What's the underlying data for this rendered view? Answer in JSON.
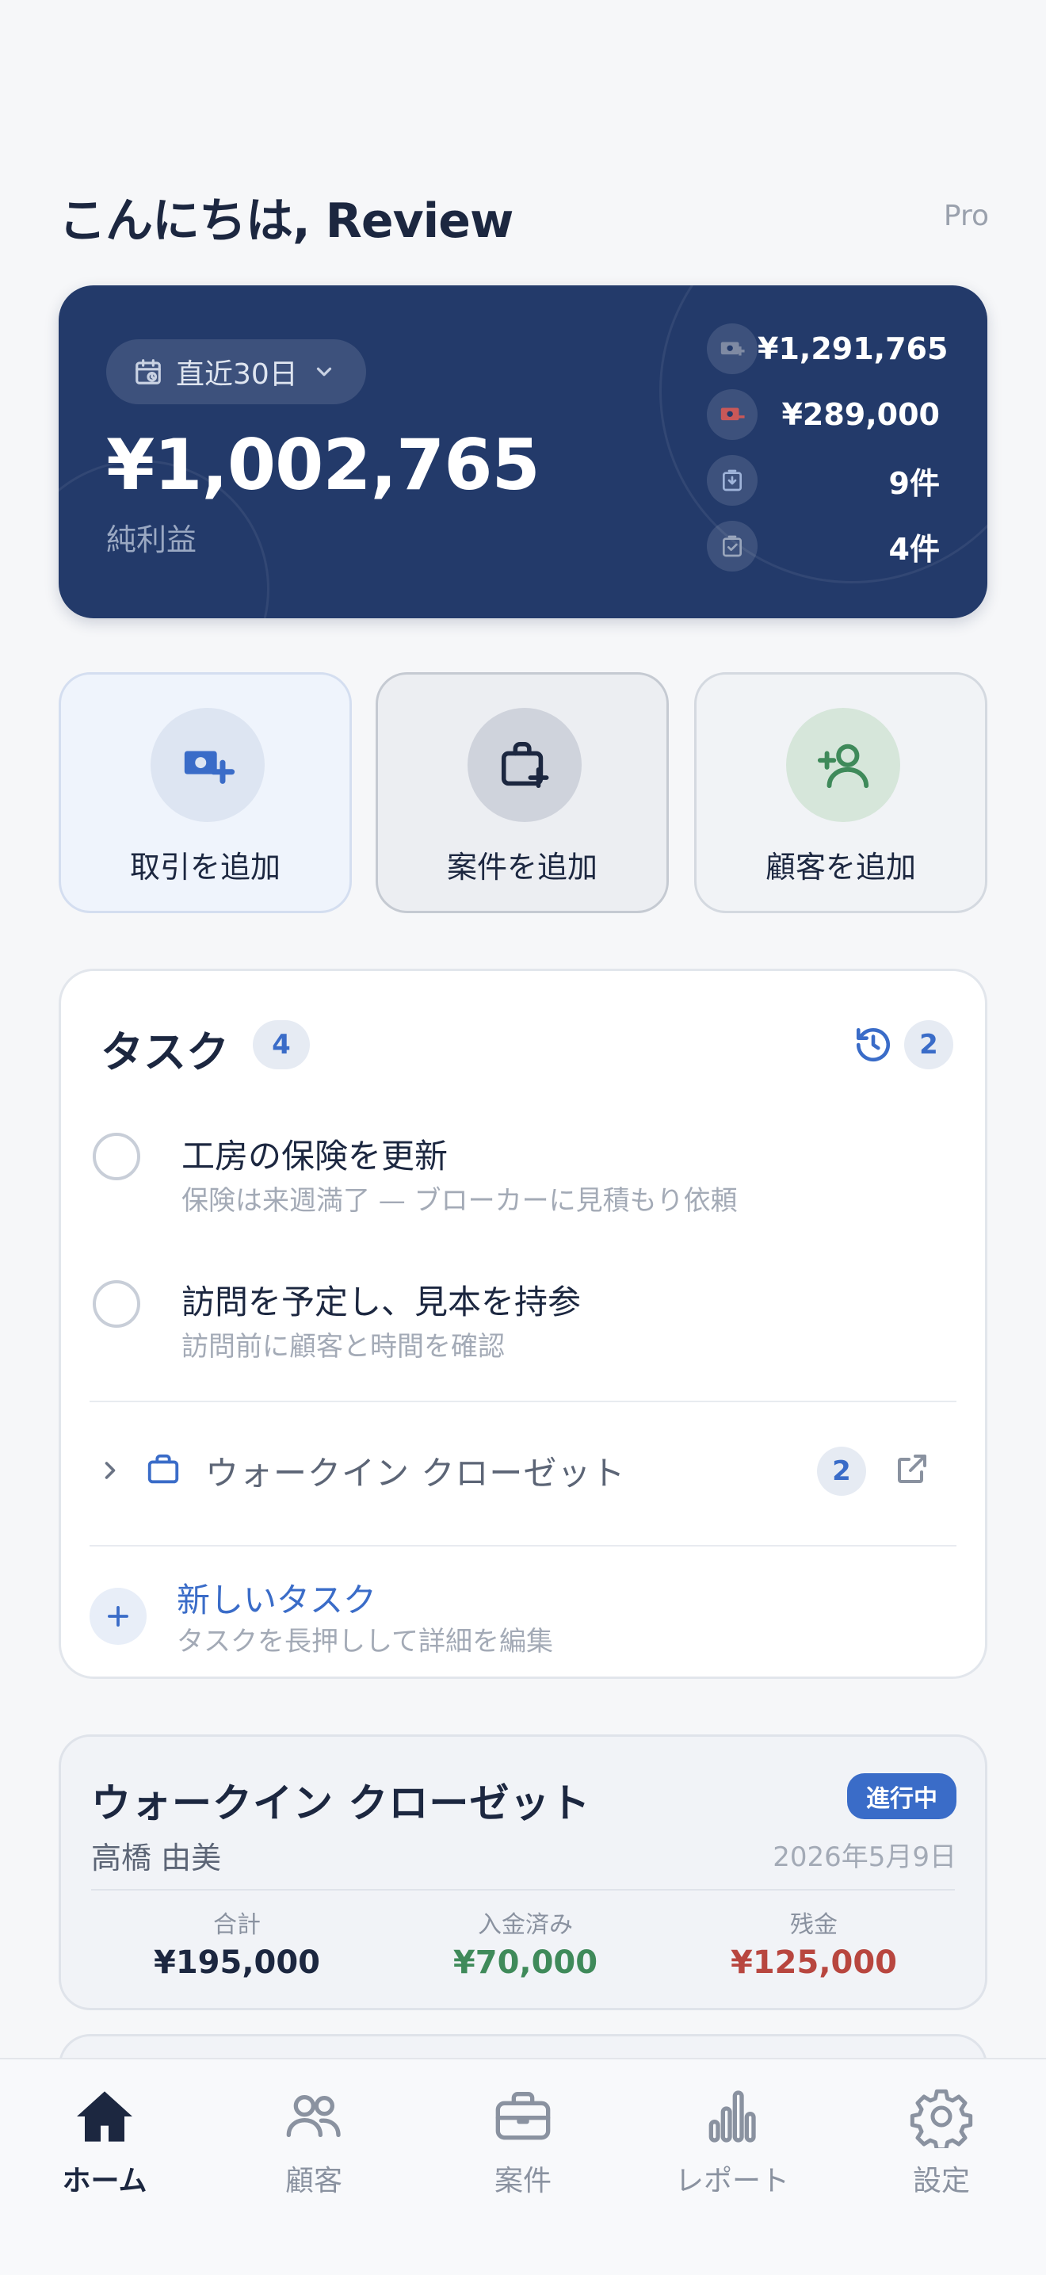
{
  "header": {
    "greeting": "こんにちは, Review",
    "plan": "Pro"
  },
  "summary": {
    "period": "直近30日",
    "net_amount": "¥1,002,765",
    "net_label": "純利益",
    "stats": [
      {
        "icon": "income-icon",
        "value": "¥1,291,765"
      },
      {
        "icon": "expense-icon",
        "value": "¥289,000"
      },
      {
        "icon": "inbox-icon",
        "value": "9件"
      },
      {
        "icon": "completed-icon",
        "value": "4件"
      }
    ]
  },
  "quick_actions": [
    {
      "label": "取引を追加",
      "icon": "add-transaction-icon"
    },
    {
      "label": "案件を追加",
      "icon": "add-project-icon"
    },
    {
      "label": "顧客を追加",
      "icon": "add-customer-icon"
    }
  ],
  "tasks": {
    "title": "タスク",
    "count": "4",
    "history_count": "2",
    "items": [
      {
        "title": "工房の保険を更新",
        "subtitle": "保険は来週満了 — ブローカーに見積もり依頼"
      },
      {
        "title": "訪問を予定し、見本を持参",
        "subtitle": "訪問前に顧客と時間を確認"
      }
    ],
    "group": {
      "label": "ウォークイン クローゼット",
      "count": "2"
    },
    "new_task": {
      "title": "新しいタスク",
      "subtitle": "タスクを長押しして詳細を編集"
    }
  },
  "project": {
    "title": "ウォークイン クローゼット",
    "status": "進行中",
    "client": "高橋 由美",
    "date": "2026年5月9日",
    "total_label": "合計",
    "total_value": "¥195,000",
    "paid_label": "入金済み",
    "paid_value": "¥70,000",
    "balance_label": "残金",
    "balance_value": "¥125,000"
  },
  "tabbar": {
    "items": [
      {
        "label": "ホーム",
        "icon": "home-icon",
        "active": true
      },
      {
        "label": "顧客",
        "icon": "customers-icon"
      },
      {
        "label": "案件",
        "icon": "briefcase-icon"
      },
      {
        "label": "レポート",
        "icon": "report-icon"
      },
      {
        "label": "設定",
        "icon": "settings-icon"
      }
    ]
  },
  "colors": {
    "card_navy": "#233a6a",
    "accent_blue": "#3a6cc8",
    "paid_green": "#3f8a5a",
    "balance_red": "#b8463f"
  }
}
